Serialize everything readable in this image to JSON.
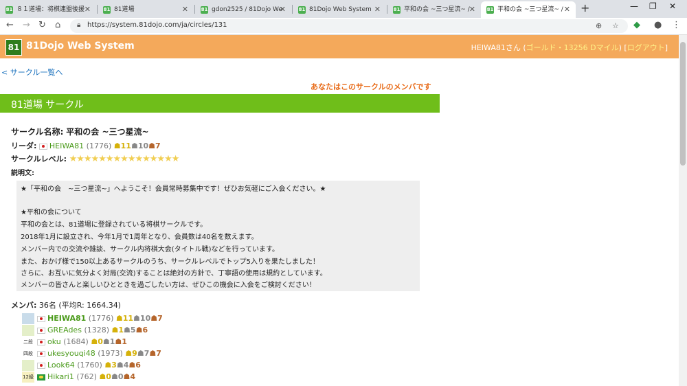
{
  "browser": {
    "tabs": [
      {
        "label": "８１道場：将棋連盟後援"
      },
      {
        "label": "81道場"
      },
      {
        "label": "gdon2525 / 81Dojo We"
      },
      {
        "label": "81Dojo Web System"
      },
      {
        "label": "平和の会 ~三つ星流~ / "
      },
      {
        "label": "平和の会 ~三つ星流~ / "
      }
    ],
    "url": "https://system.81dojo.com/ja/circles/131"
  },
  "header": {
    "logo_text": "81",
    "site_title": "81Dojo Web System",
    "user": "HEIWA81さん (",
    "user_status": "ゴールド・13256 Dマイル",
    "user_close": ") [",
    "logout": "ログアウト",
    "logout_close": "]"
  },
  "nav": {
    "back_link": "< サークル一覧へ",
    "member_note": "あなたはこのサークルのメンバです"
  },
  "circle": {
    "section_title": "81道場 サークル",
    "name_label": "サークル名称:",
    "name": "平和の会 ~三つ星流~",
    "leader_label": "リーダ:",
    "leader_name": "HEIWA81",
    "leader_rate": "(1776)",
    "leader_gold": "11",
    "leader_silver": "10",
    "leader_bronze": "7",
    "level_label": "サークルレベル:",
    "level_stars": "★★★★★★★★★★★★★★★",
    "desc_label": "説明文:",
    "description": [
      "★「平和の会　~三つ星流~」へようこそ！会員常時募集中です！ぜひお気軽にご入会ください。★",
      "",
      "★平和の会について",
      "平和の会とは、81道場に登録されている将棋サークルです。",
      "2018年1月に設立され、今年1月で1周年となり、会員数は40名を数えます。",
      "メンバー内での交流や雑談、サークル内将棋大会(タイトル戦)などを行っています。",
      "また、おかげ様で150以上あるサークルのうち、サークルレベルでトップ5入りを果たしました！",
      "さらに、お互いに気分よく対局(交流)することは絶対の方針で、丁寧語の使用は規約としています。",
      "メンバーの皆さんと楽しいひとときを過ごしたい方は、ぜひこの機会に入会をご検討ください！"
    ],
    "members_label": "メンバ:",
    "members_summary": "36名 (平均R: 1664.34)"
  },
  "members": [
    {
      "rank": "",
      "name": "HEIWA81",
      "rate": "(1776)",
      "gold": "11",
      "silver": "10",
      "bronze": "7",
      "flag": "jp"
    },
    {
      "rank": "",
      "name": "GREAdes",
      "rate": "(1328)",
      "gold": "1",
      "silver": "5",
      "bronze": "6",
      "flag": "jp"
    },
    {
      "rank": "二段",
      "name": "oku",
      "rate": "(1684)",
      "gold": "0",
      "silver": "1",
      "bronze": "1",
      "flag": "jp"
    },
    {
      "rank": "四段",
      "name": "ukesyouqi48",
      "rate": "(1973)",
      "gold": "9",
      "silver": "7",
      "bronze": "7",
      "flag": "jp"
    },
    {
      "rank": "",
      "name": "Look64",
      "rate": "(1760)",
      "gold": "3",
      "silver": "4",
      "bronze": "6",
      "flag": "jp"
    },
    {
      "rank": "12級",
      "name": "Hikari1",
      "rate": "(762)",
      "gold": "0",
      "silver": "0",
      "bronze": "4",
      "flag": "br"
    }
  ]
}
